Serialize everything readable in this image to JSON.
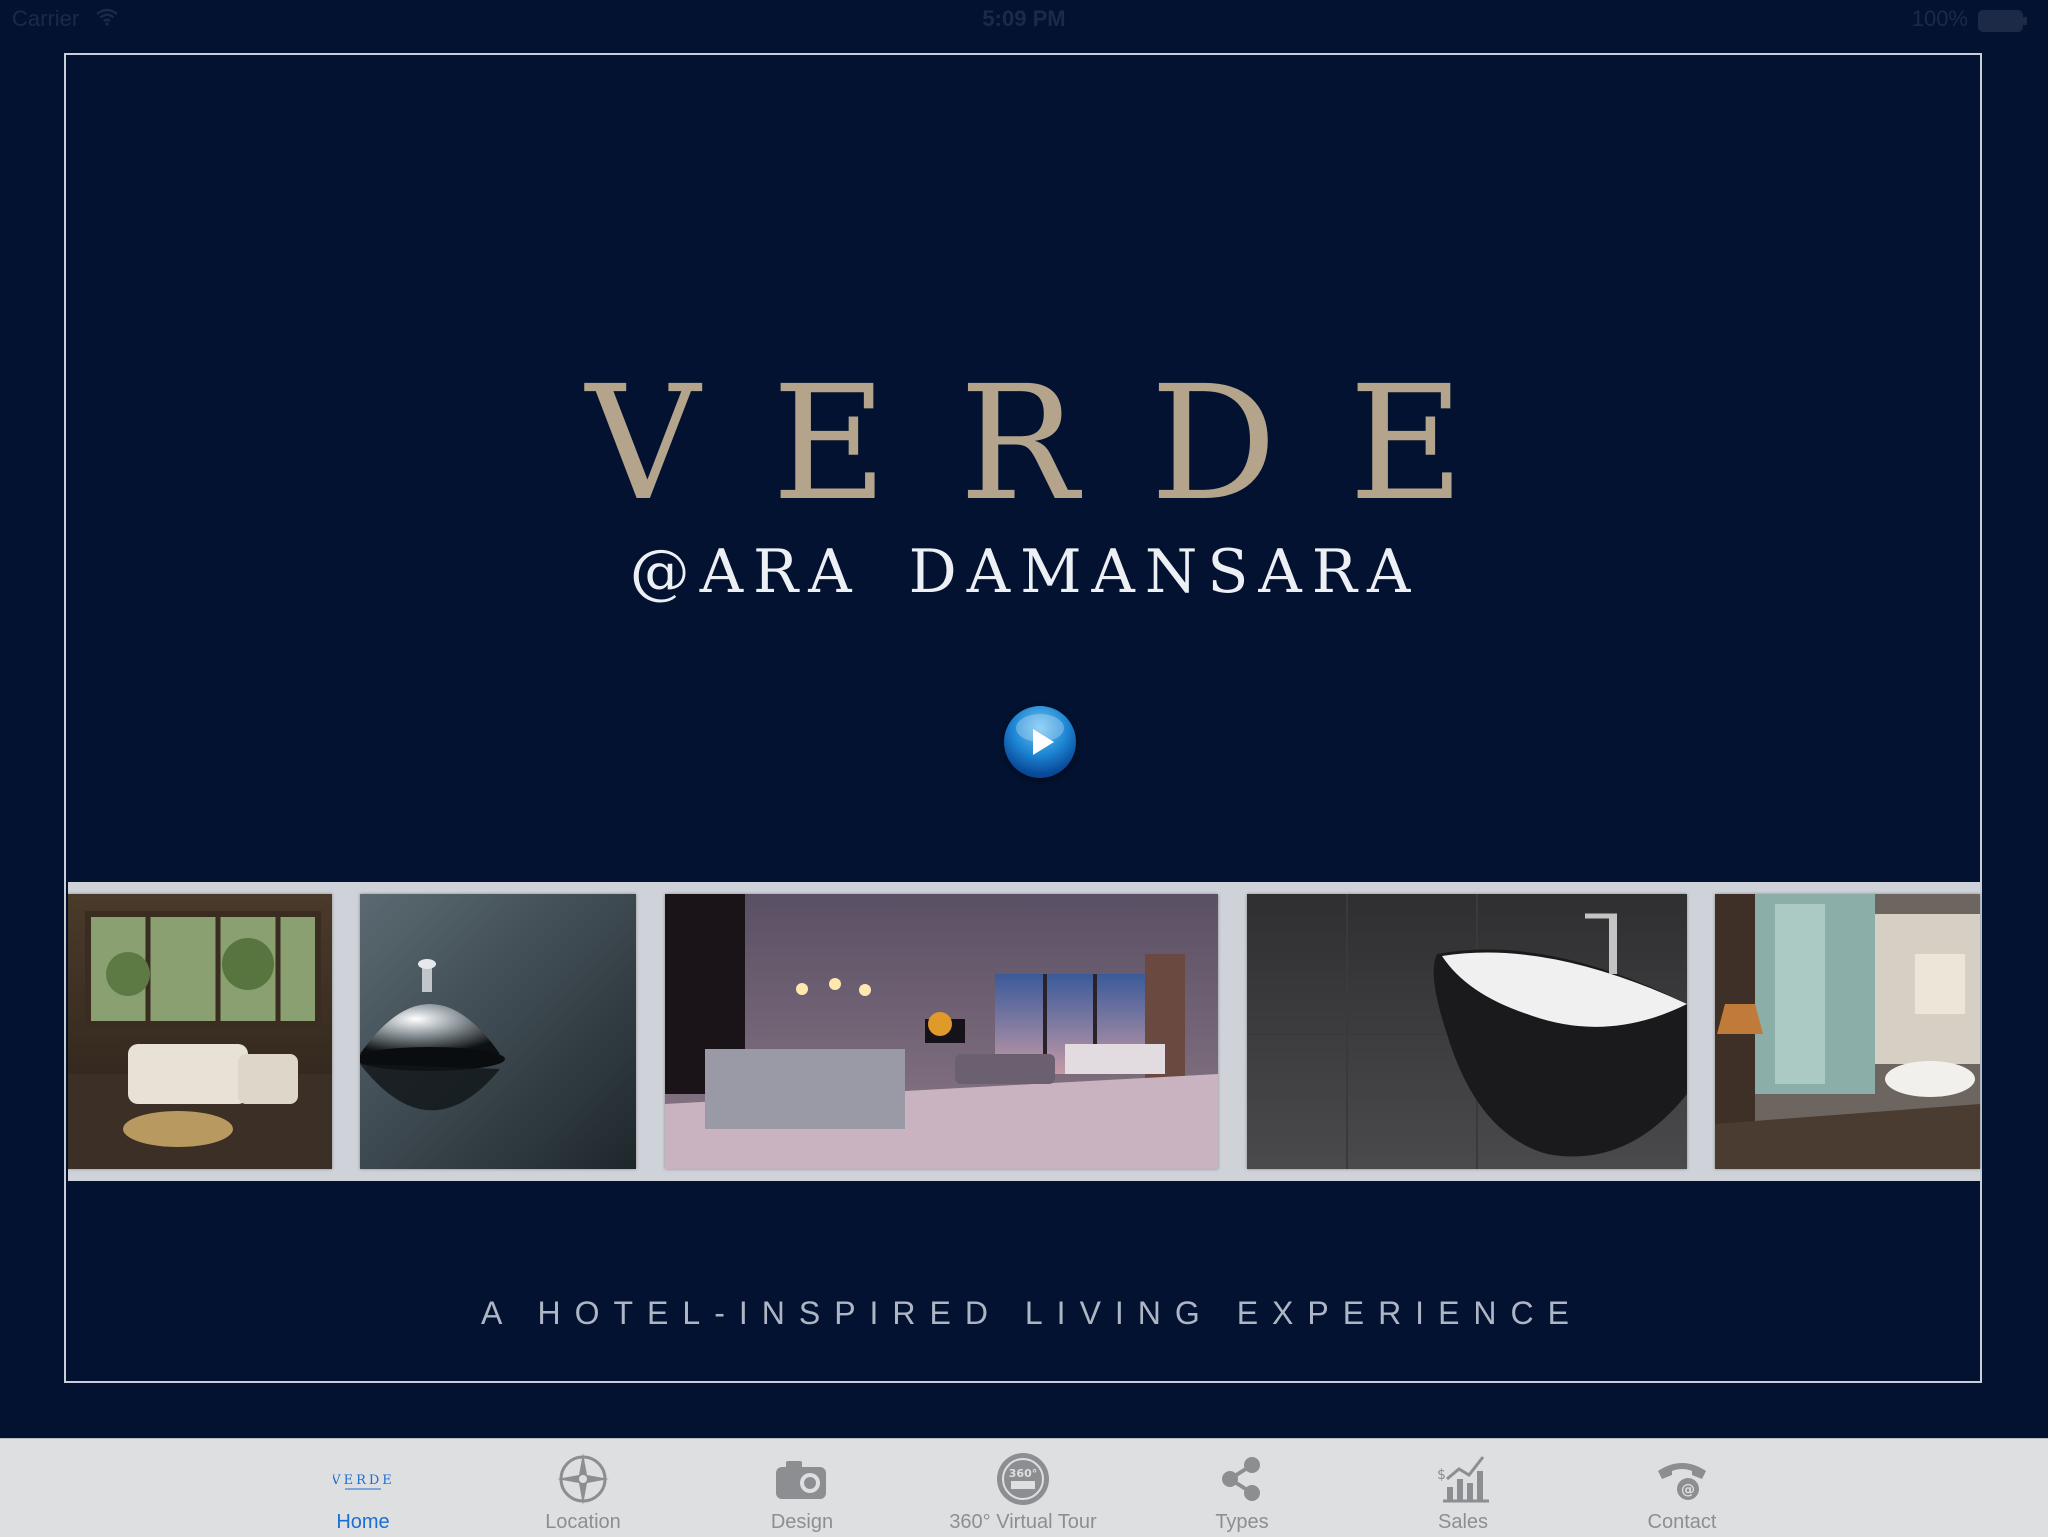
{
  "status_bar": {
    "carrier": "Carrier",
    "time": "5:09 PM",
    "battery": "100%"
  },
  "hero": {
    "title": "VERDE",
    "subtitle": "@ARA DAMANSARA",
    "play_icon": "play-icon"
  },
  "gallery": {
    "images": [
      {
        "name": "lounge-photo",
        "description": "lounge"
      },
      {
        "name": "service-bell-photo",
        "description": "service bell"
      },
      {
        "name": "living-room-photo",
        "description": "living room"
      },
      {
        "name": "bathtub-photo",
        "description": "bathtub"
      },
      {
        "name": "bathroom-photo",
        "description": "bathroom"
      }
    ]
  },
  "tagline": "A HOTEL-INSPIRED LIVING EXPERIENCE",
  "tab_bar": {
    "active_color": "#1a6fd0",
    "inactive_color": "#8d8e92",
    "home_logo_text": "VERDE",
    "tabs": [
      {
        "label": "Home",
        "icon": "verde-logo-icon",
        "active": true
      },
      {
        "label": "Location",
        "icon": "compass-icon",
        "active": false
      },
      {
        "label": "Design",
        "icon": "camera-icon",
        "active": false
      },
      {
        "label": "360° Virtual Tour",
        "icon": "virtual-tour-icon",
        "active": false
      },
      {
        "label": "Types",
        "icon": "share-icon",
        "active": false
      },
      {
        "label": "Sales",
        "icon": "sales-chart-icon",
        "active": false
      },
      {
        "label": "Contact",
        "icon": "contact-icon",
        "active": false
      }
    ]
  },
  "colors": {
    "background": "#021230",
    "title_gold": "#b3a48b",
    "frame_border": "#c9cfd8"
  }
}
